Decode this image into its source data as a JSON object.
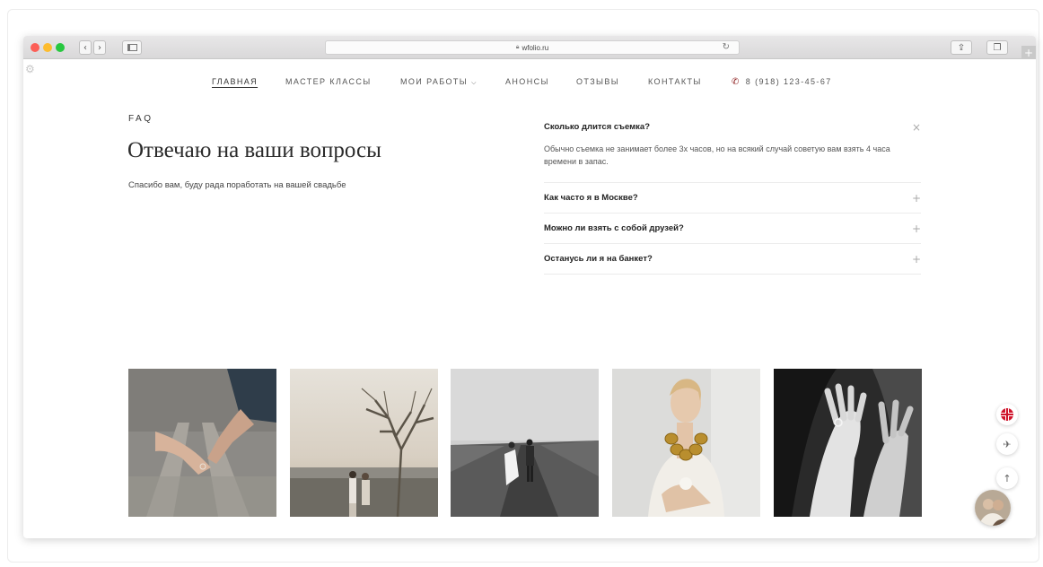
{
  "browser": {
    "url": "wfolio.ru",
    "lock_icon": "lock-icon",
    "reload_icon": "reload-icon",
    "share_icon": "share-icon",
    "tabs_icon": "tabs-icon",
    "new_tab_label": "+"
  },
  "nav": {
    "items": [
      {
        "label": "ГЛАВНАЯ",
        "active": true
      },
      {
        "label": "МАСТЕР КЛАССЫ",
        "active": false
      },
      {
        "label": "МОИ РАБОТЫ",
        "active": false
      },
      {
        "label": "АНОНСЫ",
        "active": false
      },
      {
        "label": "ОТЗЫВЫ",
        "active": false
      },
      {
        "label": "КОНТАКТЫ",
        "active": false
      }
    ],
    "dropdown_icon": "chevron-down-icon",
    "phone": "8 (918) 123-45-67",
    "phone_icon": "phone-icon"
  },
  "faq": {
    "label": "FAQ",
    "heading": "Отвечаю на ваши вопросы",
    "subtitle": "Спасибо вам, буду рада поработать на вашей свадьбе",
    "questions": [
      {
        "question": "Сколько длится съемка?",
        "answer": "Обычно съемка не занимает более 3х часов, но на всякий случай советую вам взять 4 часа времени в запас.",
        "open": true,
        "toggle": "×"
      },
      {
        "question": "Как часто я в Москве?",
        "open": false,
        "toggle": "+"
      },
      {
        "question": "Можно ли взять с собой друзей?",
        "open": false,
        "toggle": "+"
      },
      {
        "question": "Останусь ли я на банкет?",
        "open": false,
        "toggle": "+"
      }
    ]
  },
  "gallery": {
    "photos": [
      {
        "subject": "couple holding hands on railway tracks"
      },
      {
        "subject": "couple under a bare tree at sunset"
      },
      {
        "subject": "couple walking on a road in black and white"
      },
      {
        "subject": "woman with gold chain necklace"
      },
      {
        "subject": "hands close-up in black and white"
      }
    ]
  },
  "floating": {
    "language_icon": "uk-flag-icon",
    "send_icon": "paper-plane-icon",
    "up_icon": "arrow-up-icon",
    "avatar_icon": "avatar"
  }
}
